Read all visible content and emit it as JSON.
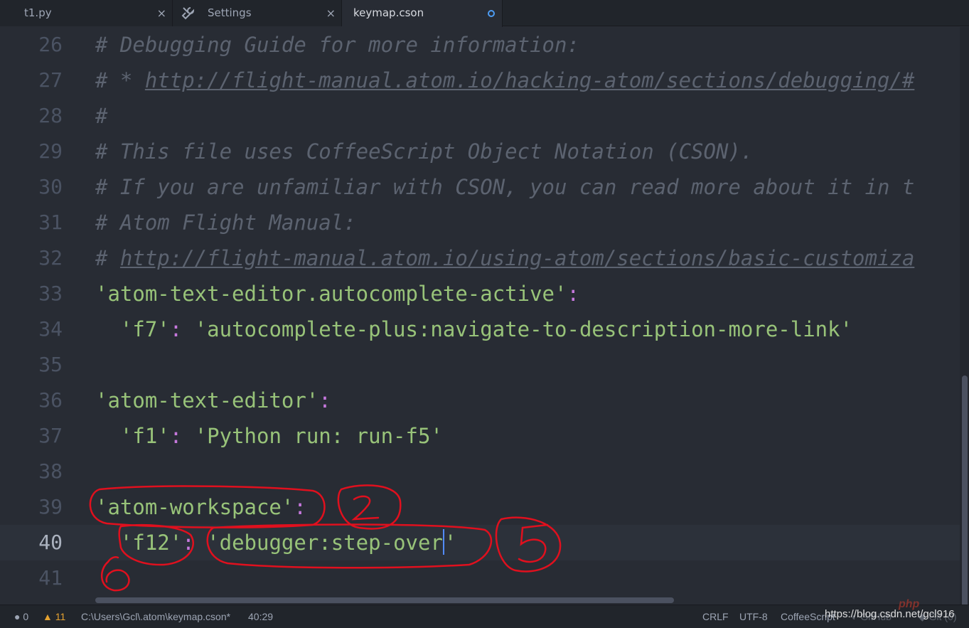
{
  "tabs": [
    {
      "label": "t1.py",
      "close": "×"
    },
    {
      "label": "Settings",
      "close": "×",
      "icon": "tools-icon"
    },
    {
      "label": "keymap.cson",
      "active": true,
      "modified": true
    }
  ],
  "editor": {
    "lines": [
      {
        "n": "26",
        "text": "# Debugging Guide for more information:"
      },
      {
        "n": "27",
        "prefix": "# * ",
        "link": "http://flight-manual.atom.io/hacking-atom/sections/debugging/#"
      },
      {
        "n": "28",
        "text": "#"
      },
      {
        "n": "29",
        "text": "# This file uses CoffeeScript Object Notation (CSON)."
      },
      {
        "n": "30",
        "text": "# If you are unfamiliar with CSON, you can read more about it in t"
      },
      {
        "n": "31",
        "text": "# Atom Flight Manual:"
      },
      {
        "n": "32",
        "prefix": "# ",
        "link": "http://flight-manual.atom.io/using-atom/sections/basic-customiza"
      },
      {
        "n": "33",
        "key": "'atom-text-editor.autocomplete-active'",
        "colon": ":"
      },
      {
        "n": "34",
        "indent": "  ",
        "key": "'f7'",
        "colon": ":",
        "value": "'autocomplete-plus:navigate-to-description-more-link'"
      },
      {
        "n": "35"
      },
      {
        "n": "36",
        "key": "'atom-text-editor'",
        "colon": ":"
      },
      {
        "n": "37",
        "indent": "  ",
        "key": "'f1'",
        "colon": ":",
        "value": "'Python run: run-f5'"
      },
      {
        "n": "38"
      },
      {
        "n": "39",
        "key": "'atom-workspace'",
        "colon": ":"
      },
      {
        "n": "40",
        "indent": "  ",
        "key": "'f12'",
        "colon": ":",
        "value": "'debugger:step-over",
        "after_cursor": "'",
        "cursor": true
      },
      {
        "n": "41"
      }
    ]
  },
  "statusbar": {
    "errors": "0",
    "warnings": "11",
    "path": "C:\\Users\\Gcl\\.atom\\keymap.cson*",
    "position": "40:29",
    "line_ending": "CRLF",
    "encoding": "UTF-8",
    "grammar": "CoffeeScript",
    "github": "GitHub",
    "git": "Git (0)",
    "watermark": "https://blog.csdn.net/gcl916",
    "php_logo": "php"
  },
  "annotations": {
    "color": "#e0101e",
    "marks": [
      "2",
      "5",
      "6"
    ]
  },
  "colors": {
    "background": "#282c34",
    "comment": "#5c6370",
    "string": "#98c379",
    "punctuation": "#c678dd",
    "cursor": "#528bff",
    "warning": "#e5a230"
  }
}
